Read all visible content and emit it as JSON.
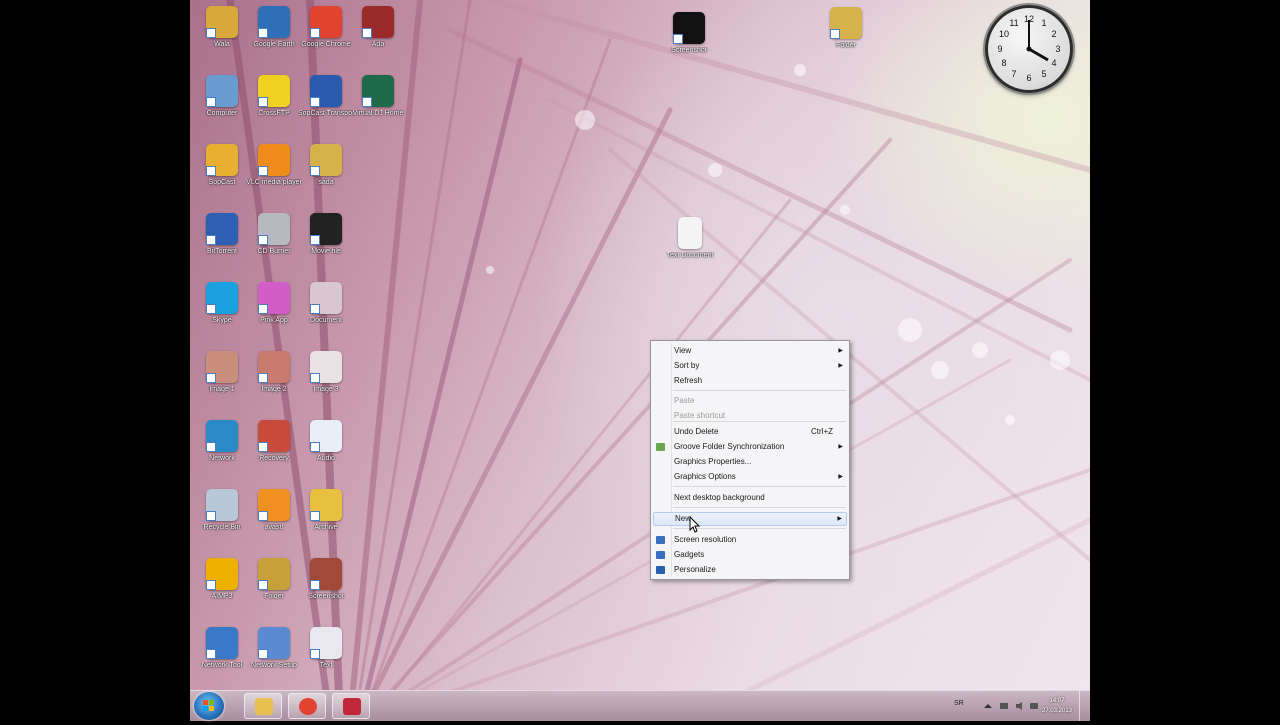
{
  "desktop": {
    "icons": [
      {
        "label": "Wala",
        "color": "#d8a93a"
      },
      {
        "label": "Google Earth",
        "color": "#2f6fb8"
      },
      {
        "label": "Google Chrome",
        "color": "#e0432f"
      },
      {
        "label": "Ada",
        "color": "#9b2a2a"
      },
      {
        "label": "Computer",
        "color": "#6a9bd0"
      },
      {
        "label": "CrossFTP",
        "color": "#f0d020"
      },
      {
        "label": "SopCast Transport",
        "color": "#2a5ab0"
      },
      {
        "label": "Virtual DJ Home",
        "color": "#1f6a4a"
      },
      {
        "label": "SopCast",
        "color": "#e8b030"
      },
      {
        "label": "VLC media player",
        "color": "#f08c1a"
      },
      {
        "label": "sada",
        "color": "#d6b34a"
      },
      {
        "label": "BitTorrent",
        "color": "#2e5fb2"
      },
      {
        "label": "CD Burner",
        "color": "#b8b8c0"
      },
      {
        "label": "Movie file",
        "color": "#222222"
      },
      {
        "label": "Skype",
        "color": "#1ba0e0"
      },
      {
        "label": "Pink App",
        "color": "#d25cc8"
      },
      {
        "label": "Document",
        "color": "#d9c7cf"
      },
      {
        "label": "Image 1",
        "color": "#c98f7c"
      },
      {
        "label": "Image 2",
        "color": "#c87a6f"
      },
      {
        "label": "Image 3",
        "color": "#e9e2e5"
      },
      {
        "label": "Network",
        "color": "#2a8ac8"
      },
      {
        "label": "Recovery",
        "color": "#c84a3a"
      },
      {
        "label": "Audio",
        "color": "#e8eef8"
      },
      {
        "label": "Recycle Bin",
        "color": "#b8c8d8"
      },
      {
        "label": "avast!",
        "color": "#f09020"
      },
      {
        "label": "Archive",
        "color": "#e8c040"
      },
      {
        "label": "AIMP3",
        "color": "#f0b000"
      },
      {
        "label": "Folder",
        "color": "#c8a03a"
      },
      {
        "label": "Screenshot",
        "color": "#a24a3a"
      },
      {
        "label": "Network Tool",
        "color": "#3a78c8"
      },
      {
        "label": "Network Setup",
        "color": "#5a8ad0"
      },
      {
        "label": "Text",
        "color": "#e8e8ee"
      }
    ],
    "top_icons": [
      {
        "label": "Screenshot",
        "color": "#111111"
      },
      {
        "label": "Folder",
        "color": "#d6b34a"
      }
    ],
    "free_icon": {
      "label": "Text Document",
      "color": "#f4f4f4"
    }
  },
  "clock": {
    "time_display": "4:00"
  },
  "context_menu": {
    "items": [
      {
        "label": "View",
        "submenu": true
      },
      {
        "label": "Sort by",
        "submenu": true
      },
      {
        "label": "Refresh"
      },
      {
        "label": "Paste",
        "disabled": true
      },
      {
        "label": "Paste shortcut",
        "disabled": true
      },
      {
        "label": "Undo Delete",
        "shortcut": "Ctrl+Z"
      },
      {
        "label": "Groove Folder Synchronization",
        "submenu": true
      },
      {
        "label": "Graphics Properties..."
      },
      {
        "label": "Graphics Options",
        "submenu": true
      },
      {
        "label": "Next desktop background"
      },
      {
        "label": "New",
        "submenu": true
      },
      {
        "label": "Screen resolution"
      },
      {
        "label": "Gadgets"
      },
      {
        "label": "Personalize"
      }
    ]
  },
  "taskbar": {
    "language": "SR",
    "time": "14:07",
    "date": "27.03.2013",
    "pinned": [
      {
        "app": "Windows Explorer",
        "color": "#e8c050"
      },
      {
        "app": "Google Chrome",
        "color": "#e0432f"
      },
      {
        "app": "Screen Recorder",
        "color": "#c0283a"
      }
    ]
  }
}
